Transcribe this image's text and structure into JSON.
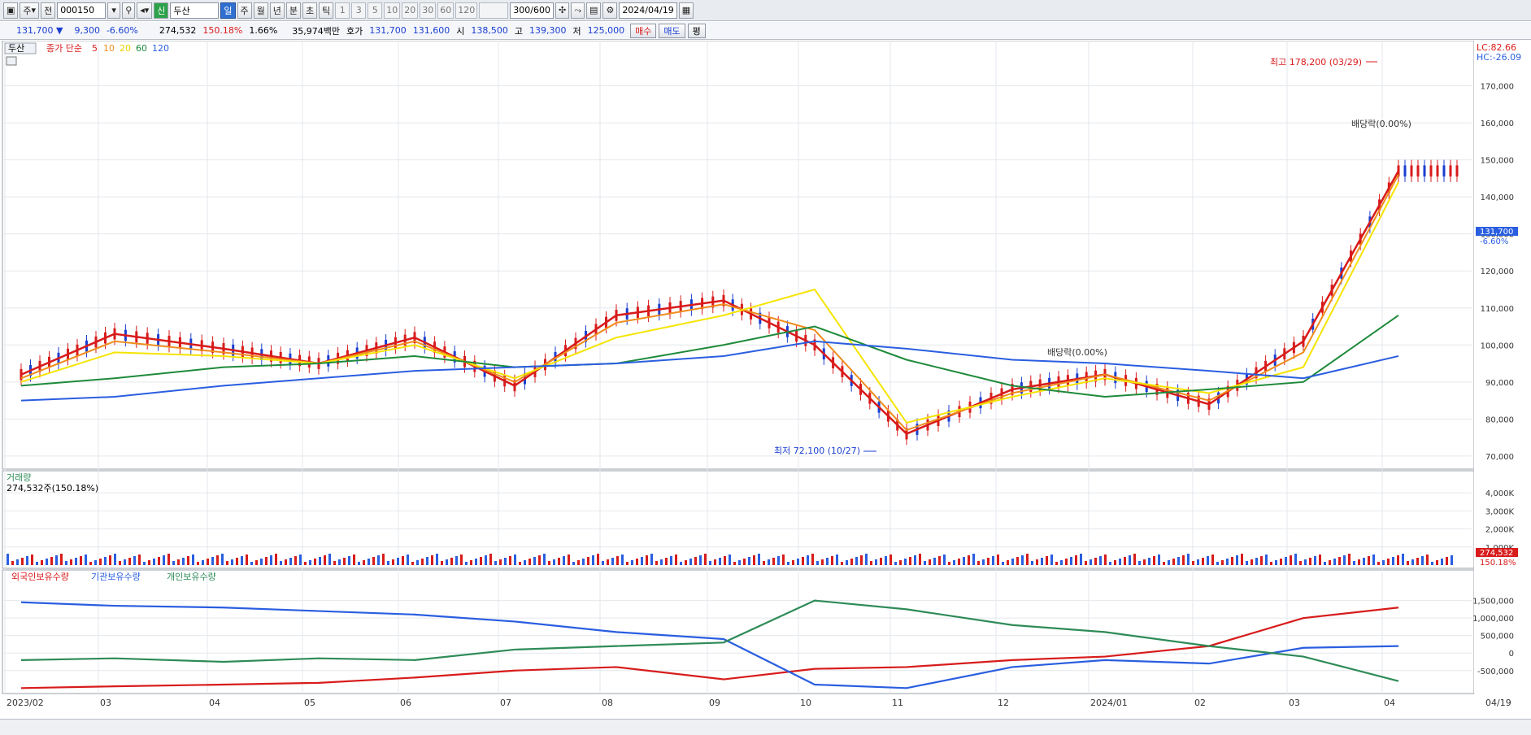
{
  "toolbar": {
    "mode": "주",
    "type": "전",
    "code": "000150",
    "name_badge": "신",
    "name": "두산",
    "periods": [
      "일",
      "주",
      "월",
      "년",
      "분",
      "초",
      "틱"
    ],
    "active_period": "일",
    "minute_opts": [
      "1",
      "3",
      "5",
      "10",
      "20",
      "30",
      "60",
      "120"
    ],
    "count": "300",
    "count_total": "/600",
    "date": "2024/04/19"
  },
  "quote": {
    "price": "131,700 ▼",
    "change": "9,300",
    "change_pct": "-6.60%",
    "volume": "274,532",
    "vol_ratio": "150.18%",
    "turnover_rate": "1.66%",
    "trade_value": "35,974백만",
    "hoga_label": "호가",
    "ask": "131,700",
    "bid": "131,600",
    "open_label": "시",
    "open": "138,500",
    "high_label": "고",
    "high": "139,300",
    "low_label": "저",
    "low": "125,000",
    "buy_btn": "매수",
    "sell_btn": "매도",
    "eval_btn": "평"
  },
  "price_panel": {
    "name_tag": "두산",
    "legend_prefix": "종가 단순",
    "ma_labels": [
      "5",
      "10",
      "20",
      "60",
      "120"
    ],
    "ma_colors": [
      "#d81b1b",
      "#f08c1c",
      "#f5e400",
      "#1e8a3a",
      "#2a5ee0"
    ],
    "lc": "LC:82.66",
    "hc": "HC:-26.09",
    "annot_high": "최고 178,200 (03/29)",
    "annot_low": "최저 72,100 (10/27)",
    "annot_div1": "배당락(0.00%)",
    "annot_div2": "배당락(0.00%)",
    "last_price_tag": "131,700",
    "last_pct_tag": "-6.60%",
    "y_ticks": [
      "170,000",
      "160,000",
      "150,000",
      "140,000",
      "130,000",
      "120,000",
      "110,000",
      "100,000",
      "90,000",
      "80,000",
      "70,000"
    ]
  },
  "volume_panel": {
    "title": "거래량",
    "value": "274,532주(150.18%)",
    "y_ticks": [
      "4,000K",
      "3,000K",
      "2,000K",
      "1,000K"
    ],
    "last_tag": "274,532",
    "last_pct": "150.18%"
  },
  "holdings_panel": {
    "legend": [
      "외국인보유수량",
      "기관보유수량",
      "개인보유수량"
    ],
    "colors": [
      "#d81b1b",
      "#2a5ee0",
      "#2e8b57"
    ],
    "y_ticks": [
      "1,500,000",
      "1,000,000",
      "500,000",
      "0",
      "-500,000"
    ]
  },
  "x_axis": [
    "2023/02",
    "03",
    "04",
    "05",
    "06",
    "07",
    "08",
    "09",
    "10",
    "11",
    "12",
    "2024/01",
    "02",
    "03",
    "04",
    "04/19"
  ],
  "chart_data": {
    "type": "line",
    "title": "두산",
    "ylim": [
      68000,
      180000
    ],
    "x": [
      "2023/02",
      "03",
      "04",
      "05",
      "06",
      "07",
      "08",
      "09",
      "10",
      "11",
      "12",
      "2024/01",
      "02",
      "03",
      "04"
    ],
    "series": [
      {
        "name": "5",
        "values": [
          92000,
          103000,
          99000,
          95000,
          102000,
          89000,
          108000,
          112000,
          100000,
          76000,
          88000,
          92000,
          84000,
          101000,
          147000
        ]
      },
      {
        "name": "10",
        "values": [
          91000,
          101000,
          98000,
          95000,
          101000,
          90000,
          106000,
          111000,
          104000,
          77000,
          87000,
          92000,
          85000,
          98000,
          146000
        ]
      },
      {
        "name": "20",
        "values": [
          90000,
          98000,
          97000,
          95000,
          100000,
          91000,
          102000,
          108000,
          115000,
          79000,
          86000,
          91000,
          87000,
          94000,
          144000
        ]
      },
      {
        "name": "60",
        "values": [
          89000,
          91000,
          94000,
          95000,
          97000,
          94000,
          95000,
          100000,
          105000,
          96000,
          89000,
          86000,
          88000,
          90000,
          108000
        ]
      },
      {
        "name": "120",
        "values": [
          85000,
          86000,
          89000,
          91000,
          93000,
          94000,
          95000,
          97000,
          101000,
          99000,
          96000,
          95000,
          93000,
          91000,
          97000
        ]
      }
    ]
  }
}
